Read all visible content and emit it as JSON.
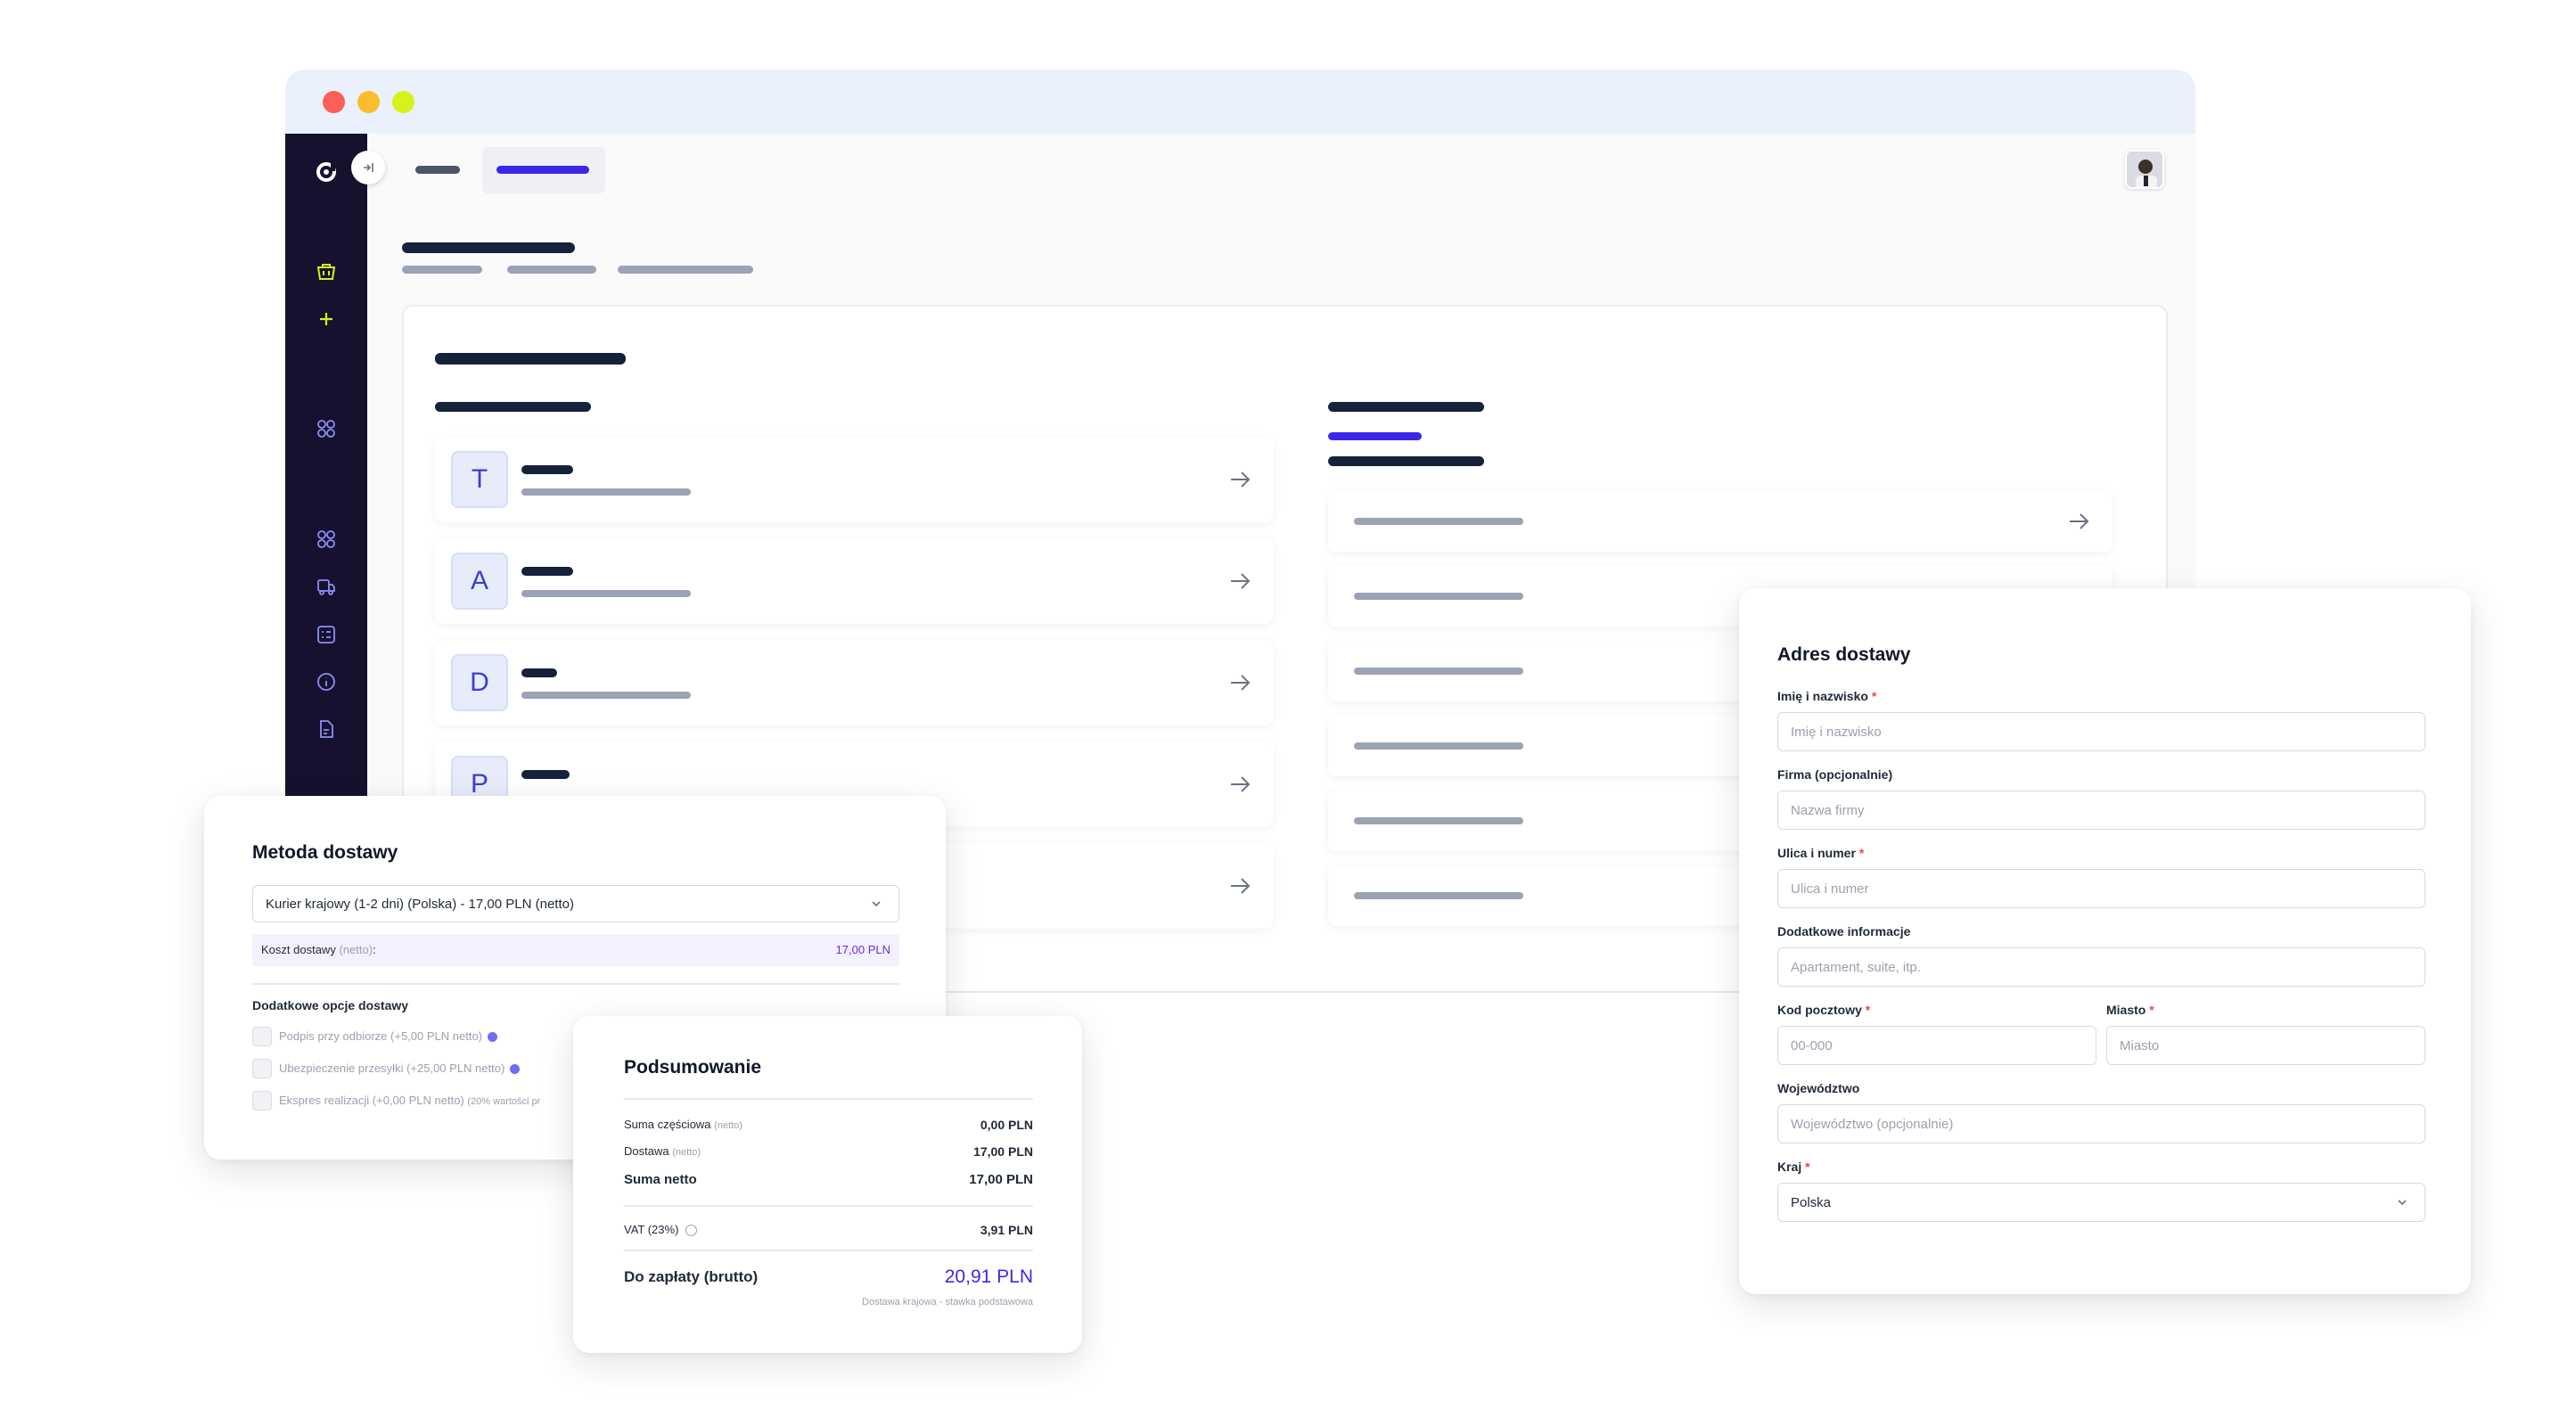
{
  "window": {
    "colors": {
      "titlebar": "#eaf0fc",
      "sidebar": "#16112f",
      "accent": "#3b27e8",
      "lime": "#d6f21b"
    }
  },
  "sidebar": {
    "items": [
      {
        "icon": "logo-icon"
      },
      {
        "icon": "basket-icon"
      },
      {
        "icon": "plus-icon"
      },
      {
        "icon": "apps-icon"
      },
      {
        "icon": "apps-icon"
      },
      {
        "icon": "truck-icon"
      },
      {
        "icon": "list-icon"
      },
      {
        "icon": "info-icon"
      },
      {
        "icon": "document-icon"
      }
    ]
  },
  "list": {
    "items": [
      {
        "letter": "T"
      },
      {
        "letter": "A"
      },
      {
        "letter": "D"
      },
      {
        "letter": "P"
      }
    ]
  },
  "shipping_method": {
    "title": "Metoda dostawy",
    "selected": "Kurier krajowy (1-2 dni) (Polska) - 17,00 PLN (netto)",
    "cost_label": "Koszt dostawy",
    "cost_qualifier": "(netto)",
    "cost_colon": ":",
    "cost_value": "17,00 PLN",
    "extras_title": "Dodatkowe opcje dostawy",
    "options": [
      {
        "label": "Podpis przy odbiorze",
        "price": "(+5,00 PLN netto)"
      },
      {
        "label": "Ubezpieczenie przesyłki",
        "price": "(+25,00 PLN netto)"
      },
      {
        "label": "Ekspres realizacji",
        "price": "(+0,00 PLN netto)",
        "note": "(20% wartości pr"
      }
    ]
  },
  "summary": {
    "title": "Podsumowanie",
    "subtotal_label": "Suma częściowa",
    "subtotal_qualifier": "(netto)",
    "subtotal_value": "0,00 PLN",
    "shipping_label": "Dostawa",
    "shipping_qualifier": "(netto)",
    "shipping_value": "17,00 PLN",
    "net_label": "Suma netto",
    "net_value": "17,00 PLN",
    "vat_label": "VAT (23%)",
    "vat_value": "3,91 PLN",
    "total_label": "Do zapłaty (brutto)",
    "total_value": "20,91 PLN",
    "footnote": "Dostawa krajowa - stawka podstawowa"
  },
  "address": {
    "title": "Adres dostawy",
    "name_label": "Imię i nazwisko",
    "name_placeholder": "Imię i nazwisko",
    "company_label": "Firma (opcjonalnie)",
    "company_placeholder": "Nazwa firmy",
    "street_label": "Ulica i numer",
    "street_placeholder": "Ulica i numer",
    "extra_label": "Dodatkowe informacje",
    "extra_placeholder": "Apartament, suite, itp.",
    "zip_label": "Kod pocztowy",
    "zip_placeholder": "00-000",
    "city_label": "Miasto",
    "city_placeholder": "Miasto",
    "region_label": "Województwo",
    "region_placeholder": "Województwo (opcjonalnie)",
    "country_label": "Kraj",
    "country_value": "Polska",
    "required_mark": "*"
  }
}
